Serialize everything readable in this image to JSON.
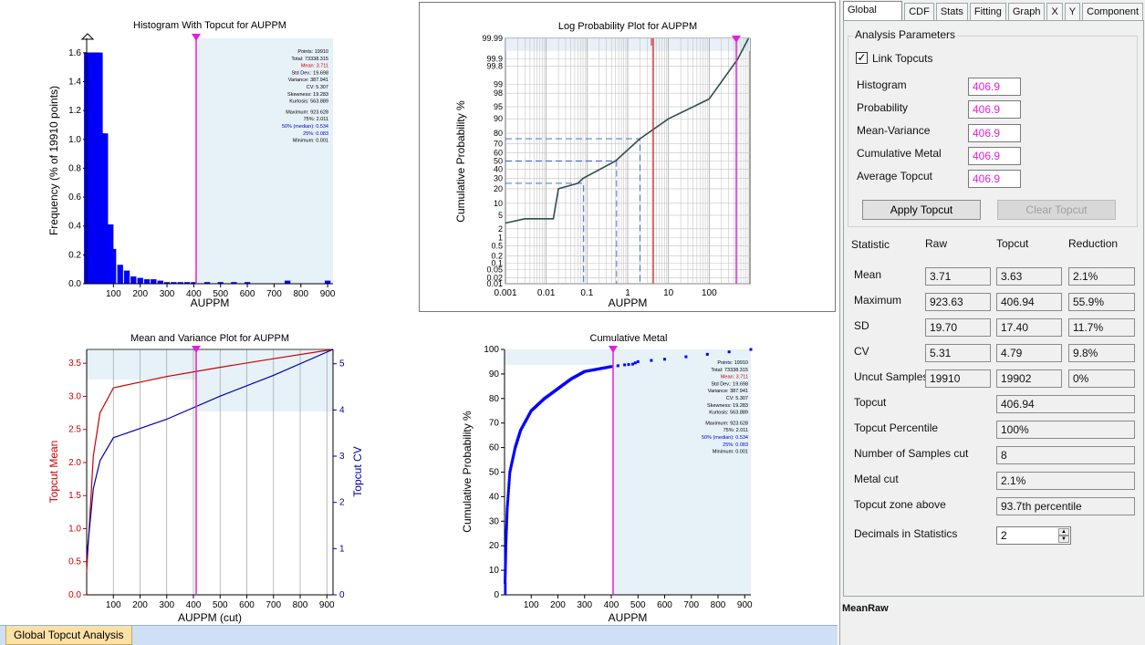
{
  "charts": {
    "histogram": {
      "title": "Histogram With Topcut for AUPPM",
      "xlabel": "AUPPM",
      "ylabel": "Frequency (% of 19910 points)",
      "xticks": [
        "100",
        "200",
        "300",
        "400",
        "500",
        "600",
        "700",
        "800",
        "900"
      ],
      "yticks": [
        "0.0",
        "0.2",
        "0.4",
        "0.6",
        "0.8",
        "1.0",
        "1.2",
        "1.4",
        "1.6"
      ]
    },
    "logprob": {
      "title": "Log Probability Plot for AUPPM",
      "xlabel": "AUPPM",
      "ylabel": "Cumulative Probability %",
      "xticks": [
        "0.001",
        "0.01",
        "0.1",
        "1",
        "10",
        "100"
      ],
      "yticks": [
        "99.99",
        "99.9",
        "99.8",
        "99",
        "98",
        "95",
        "90",
        "80",
        "70",
        "60",
        "50",
        "40",
        "30",
        "20",
        "10",
        "5",
        "2",
        "1",
        "0.5",
        "0.2",
        "0.1",
        "0.05",
        "0.02",
        "0.01"
      ]
    },
    "meanvar": {
      "title": "Mean and Variance Plot for AUPPM",
      "xlabel": "AUPPM (cut)",
      "ylabel_left": "Topcut Mean",
      "ylabel_right": "Topcut CV",
      "xticks": [
        "100",
        "200",
        "300",
        "400",
        "500",
        "600",
        "700",
        "800",
        "900"
      ],
      "yticks_left": [
        "0.0",
        "0.5",
        "1.0",
        "1.5",
        "2.0",
        "2.5",
        "3.0",
        "3.5"
      ],
      "yticks_right": [
        "0",
        "1",
        "2",
        "3",
        "4",
        "5"
      ]
    },
    "cummetal": {
      "title": "Cumulative Metal",
      "xlabel": "AUPPM",
      "ylabel": "Cumulative Probability %",
      "xticks": [
        "100",
        "200",
        "300",
        "400",
        "500",
        "600",
        "700",
        "800",
        "900"
      ],
      "yticks": [
        "0",
        "10",
        "20",
        "30",
        "40",
        "50",
        "60",
        "70",
        "80",
        "90",
        "100"
      ]
    },
    "stats_box": [
      [
        "Points:",
        "19910"
      ],
      [
        "Total:",
        "73338.315"
      ],
      [
        "Mean:",
        "3.711"
      ],
      [
        "Std Dev.:",
        "19.698"
      ],
      [
        "Variance:",
        "387.941"
      ],
      [
        "CV:",
        "5.307"
      ],
      [
        "Skewness:",
        "19.283"
      ],
      [
        "Kurtosis:",
        "563.889"
      ],
      [
        "Maximum:",
        "923.628"
      ],
      [
        "75%:",
        "2.011"
      ],
      [
        "50% (median):",
        "0.534"
      ],
      [
        "25%:",
        "0.083"
      ],
      [
        "Minimum:",
        "0.001"
      ]
    ]
  },
  "chart_data": [
    {
      "type": "bar",
      "title": "Histogram With Topcut for AUPPM",
      "xlabel": "AUPPM",
      "ylabel": "Frequency (% of 19910 points)",
      "x": [
        5,
        15,
        25,
        35,
        45,
        55,
        65,
        75,
        85,
        95,
        125,
        150,
        175,
        200,
        225,
        250,
        275,
        300,
        325,
        350,
        375,
        400,
        450,
        500,
        550,
        600,
        750,
        900
      ],
      "values": [
        1.6,
        1.6,
        1.6,
        1.6,
        1.6,
        1.04,
        1.04,
        0.41,
        0.41,
        0.24,
        0.13,
        0.09,
        0.05,
        0.04,
        0.03,
        0.03,
        0.02,
        0.01,
        0.01,
        0.01,
        0.01,
        0.01,
        0.01,
        0.01,
        0.01,
        0.01,
        0.02,
        0.02
      ],
      "xlim": [
        0,
        920
      ],
      "ylim": [
        0,
        1.7
      ],
      "topcut": 406.9
    },
    {
      "type": "line",
      "title": "Log Probability Plot for AUPPM",
      "xlabel": "AUPPM",
      "ylabel": "Cumulative Probability %",
      "x": [
        0.001,
        0.003,
        0.015,
        0.02,
        0.06,
        0.08,
        0.5,
        2,
        10,
        100,
        500,
        923
      ],
      "y": [
        3,
        4,
        4,
        20,
        25,
        30,
        50,
        75,
        90,
        97,
        99.9,
        99.99
      ],
      "xlim": [
        0.001,
        1000
      ],
      "scale": "log-probability",
      "topcut": 406.9
    },
    {
      "type": "line",
      "title": "Mean and Variance Plot for AUPPM",
      "xlabel": "AUPPM (cut)",
      "series": [
        {
          "name": "Topcut Mean",
          "x": [
            0,
            25,
            50,
            100,
            300,
            500,
            700,
            923
          ],
          "y": [
            0.35,
            2.1,
            2.75,
            3.13,
            3.3,
            3.44,
            3.57,
            3.71
          ]
        },
        {
          "name": "Topcut CV",
          "x": [
            0,
            25,
            50,
            100,
            300,
            500,
            700,
            923
          ],
          "y": [
            0.8,
            2.3,
            2.9,
            3.4,
            3.8,
            4.3,
            4.75,
            5.31
          ]
        }
      ],
      "xlim": [
        0,
        923
      ],
      "ylim_left": [
        0,
        3.71
      ],
      "ylim_right": [
        0,
        5.31
      ],
      "topcut": 406.9
    },
    {
      "type": "scatter",
      "title": "Cumulative Metal",
      "xlabel": "AUPPM",
      "ylabel": "Cumulative Probability %",
      "x": [
        2,
        5,
        10,
        20,
        40,
        60,
        100,
        150,
        200,
        250,
        300,
        350,
        400,
        450,
        480,
        500,
        600,
        760,
        923
      ],
      "y": [
        5,
        20,
        35,
        50,
        60,
        67,
        75,
        80,
        84,
        88,
        91,
        92,
        93,
        93.7,
        94,
        95,
        96,
        98,
        99.99
      ],
      "xlim": [
        0,
        923
      ],
      "ylim": [
        0,
        100
      ],
      "topcut": 406.9
    }
  ],
  "panel": {
    "tabs": [
      "Global Topcut",
      "CDF",
      "Stats",
      "Fitting",
      "Graph",
      "X",
      "Y",
      "Component"
    ],
    "analysis_params_label": "Analysis Parameters",
    "link_topcuts_label": "Link Topcuts",
    "link_checked": true,
    "params": [
      {
        "label": "Histogram",
        "value": "406.9"
      },
      {
        "label": "Probability",
        "value": "406.9"
      },
      {
        "label": "Mean-Variance",
        "value": "406.9"
      },
      {
        "label": "Cumulative Metal",
        "value": "406.9"
      },
      {
        "label": "Average Topcut",
        "value": "406.9"
      }
    ],
    "apply_label": "Apply Topcut",
    "clear_label": "Clear Topcut",
    "headers": [
      "Statistic",
      "Raw",
      "Topcut",
      "Reduction"
    ],
    "rows": [
      {
        "label": "Mean",
        "raw": "3.71",
        "topcut": "3.63",
        "reduction": "2.1%"
      },
      {
        "label": "Maximum",
        "raw": "923.63",
        "topcut": "406.94",
        "reduction": "55.9%"
      },
      {
        "label": "SD",
        "raw": "19.70",
        "topcut": "17.40",
        "reduction": "11.7%"
      },
      {
        "label": "CV",
        "raw": "5.31",
        "topcut": "4.79",
        "reduction": "9.8%"
      },
      {
        "label": "Uncut Samples",
        "raw": "19910",
        "topcut": "19902",
        "reduction": "0%"
      }
    ],
    "summary": [
      {
        "label": "Topcut",
        "value": "406.94"
      },
      {
        "label": "Topcut Percentile",
        "value": "100%"
      },
      {
        "label": "Number of Samples cut",
        "value": "8"
      },
      {
        "label": "Metal cut",
        "value": "2.1%"
      },
      {
        "label": "Topcut zone above",
        "value": "93.7th percentile"
      }
    ],
    "decimals_label": "Decimals in Statistics",
    "decimals_value": "2",
    "footer_label": "MeanRaw"
  },
  "bottom_tab": "Global Topcut Analysis",
  "colors": {
    "accent": "#e020e0",
    "shade": "#e6f1f8",
    "bars": "#0000ff",
    "mean": "#cc0000",
    "cv": "#0000aa"
  }
}
